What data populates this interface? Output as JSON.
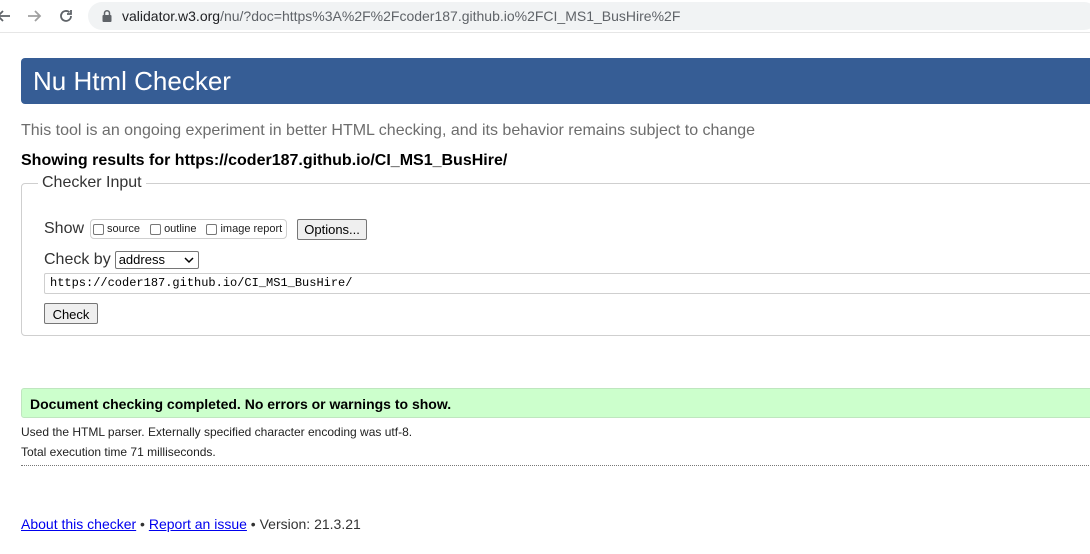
{
  "browser": {
    "url_host": "validator.w3.org",
    "url_rest": "/nu/?doc=https%3A%2F%2Fcoder187.github.io%2FCI_MS1_BusHire%2F",
    "back_icon": "arrow-left-icon",
    "forward_icon": "arrow-right-icon",
    "reload_icon": "reload-icon",
    "lock_icon": "lock-icon"
  },
  "header": {
    "title": "Nu Html Checker",
    "background_color": "#365d95"
  },
  "intro": {
    "subtitle": "This tool is an ongoing experiment in better HTML checking, and its behavior remains subject to change",
    "showing_prefix": "Showing results for ",
    "showing_url": "https://coder187.github.io/CI_MS1_BusHire/"
  },
  "checker_input": {
    "legend": "Checker Input",
    "show_label": "Show",
    "show_options": [
      {
        "label": "source",
        "checked": false
      },
      {
        "label": "outline",
        "checked": false
      },
      {
        "label": "image report",
        "checked": false
      }
    ],
    "options_button": "Options...",
    "check_by_label": "Check by",
    "check_by_selected": "address",
    "address_value": "https://coder187.github.io/CI_MS1_BusHire/",
    "check_button": "Check"
  },
  "result": {
    "message": "Document checking completed. No errors or warnings to show.",
    "message_bg": "#ccffcc",
    "parser_info": "Used the HTML parser. Externally specified character encoding was utf-8.",
    "timing_info": "Total execution time 71 milliseconds."
  },
  "footer": {
    "about_link": "About this checker",
    "separator": " • ",
    "report_link": "Report an issue",
    "version_text": " • Version: 21.3.21"
  }
}
